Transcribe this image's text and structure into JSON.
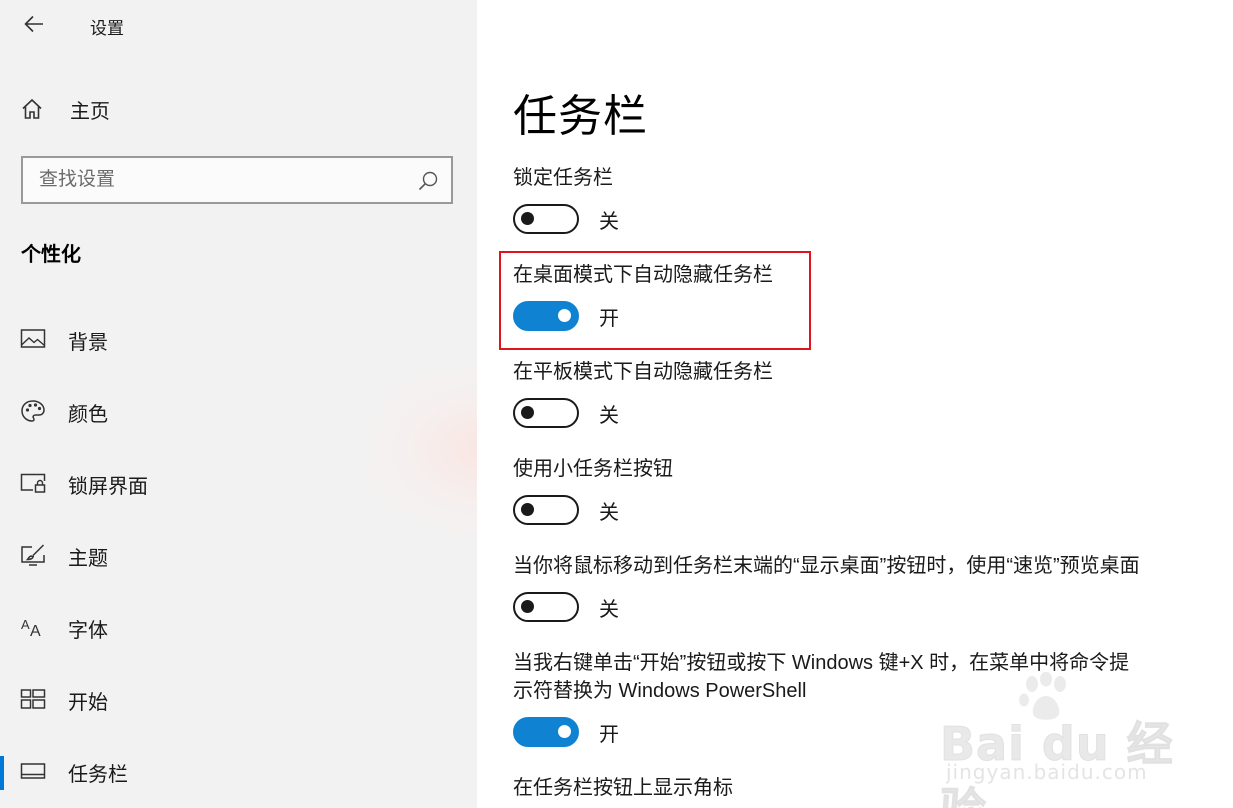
{
  "window": {
    "title": "设置",
    "back_icon": "arrow-left-icon"
  },
  "sidebar": {
    "home": {
      "label": "主页",
      "icon": "home-icon"
    },
    "search": {
      "placeholder": "查找设置",
      "icon": "search-icon"
    },
    "section_title": "个性化",
    "items": [
      {
        "label": "背景",
        "icon": "picture-icon",
        "active": false
      },
      {
        "label": "颜色",
        "icon": "palette-icon",
        "active": false
      },
      {
        "label": "锁屏界面",
        "icon": "lock-screen-icon",
        "active": false
      },
      {
        "label": "主题",
        "icon": "theme-brush-icon",
        "active": false
      },
      {
        "label": "字体",
        "icon": "font-icon",
        "active": false
      },
      {
        "label": "开始",
        "icon": "start-tiles-icon",
        "active": false
      },
      {
        "label": "任务栏",
        "icon": "taskbar-icon",
        "active": true
      }
    ],
    "accent_color": "#0078d7"
  },
  "main": {
    "title": "任务栏",
    "settings": [
      {
        "label": "锁定任务栏",
        "on": false,
        "state": "关"
      },
      {
        "label": "在桌面模式下自动隐藏任务栏",
        "on": true,
        "state": "开",
        "highlighted": true
      },
      {
        "label": "在平板模式下自动隐藏任务栏",
        "on": false,
        "state": "关"
      },
      {
        "label": "使用小任务栏按钮",
        "on": false,
        "state": "关"
      },
      {
        "label": "当你将鼠标移动到任务栏末端的“显示桌面”按钮时，使用“速览”预览桌面",
        "on": false,
        "state": "关"
      },
      {
        "label_line1": "当我右键单击“开始”按钮或按下 Windows 键+X 时，在菜单中将命令提",
        "label_line2": "示符替换为 Windows PowerShell",
        "on": true,
        "state": "开"
      },
      {
        "label": "在任务栏按钮上显示角标"
      }
    ],
    "toggle_on_color": "#0f83d2",
    "highlight_color": "#e0141e"
  },
  "watermark": {
    "text": "Bai du 经验",
    "sub": "jingyan.baidu.com"
  }
}
